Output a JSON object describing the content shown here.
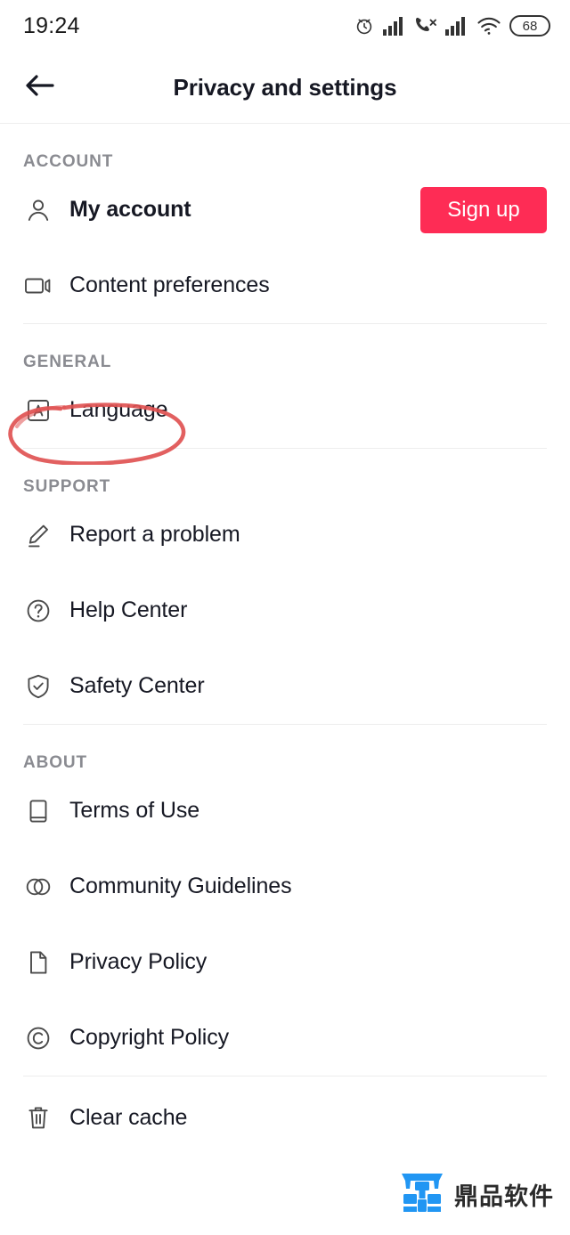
{
  "status_bar": {
    "time": "19:24",
    "icons": [
      "alarm-clock-icon",
      "signal-bars-icon",
      "call-missed-icon",
      "signal-bars-icon",
      "wifi-icon"
    ],
    "battery_level": "68"
  },
  "header": {
    "back_icon": "arrow-left-icon",
    "title": "Privacy and settings"
  },
  "sections": [
    {
      "label": "ACCOUNT",
      "rows": [
        {
          "icon": "person-icon",
          "label": "My account",
          "bold": true,
          "action_label": "Sign up"
        },
        {
          "icon": "video-camera-icon",
          "label": "Content preferences",
          "bold": false
        }
      ]
    },
    {
      "label": "GENERAL",
      "rows": [
        {
          "icon": "language-a-box-icon",
          "label": "Language",
          "bold": false
        }
      ]
    },
    {
      "label": "SUPPORT",
      "rows": [
        {
          "icon": "pencil-icon",
          "label": "Report a problem",
          "bold": false
        },
        {
          "icon": "question-circle-icon",
          "label": "Help Center",
          "bold": false
        },
        {
          "icon": "shield-check-icon",
          "label": "Safety Center",
          "bold": false
        }
      ]
    },
    {
      "label": "ABOUT",
      "rows": [
        {
          "icon": "book-icon",
          "label": "Terms of Use",
          "bold": false
        },
        {
          "icon": "two-circles-icon",
          "label": "Community Guidelines",
          "bold": false
        },
        {
          "icon": "file-icon",
          "label": "Privacy Policy",
          "bold": false
        },
        {
          "icon": "copyright-icon",
          "label": "Copyright Policy",
          "bold": false
        }
      ]
    },
    {
      "label": "",
      "rows": [
        {
          "icon": "trash-icon",
          "label": "Clear cache",
          "bold": false
        }
      ]
    }
  ],
  "annotation": {
    "shape": "hand-drawn-ellipse",
    "target": "Language",
    "color": "#e05252"
  },
  "watermark": {
    "logo_name": "dingpin-software-logo",
    "text": "鼎品软件",
    "logo_color": "#2196f3"
  },
  "colors": {
    "accent": "#fe2c55",
    "text": "#161823",
    "muted": "#8a8b91",
    "divider": "#ededed"
  }
}
